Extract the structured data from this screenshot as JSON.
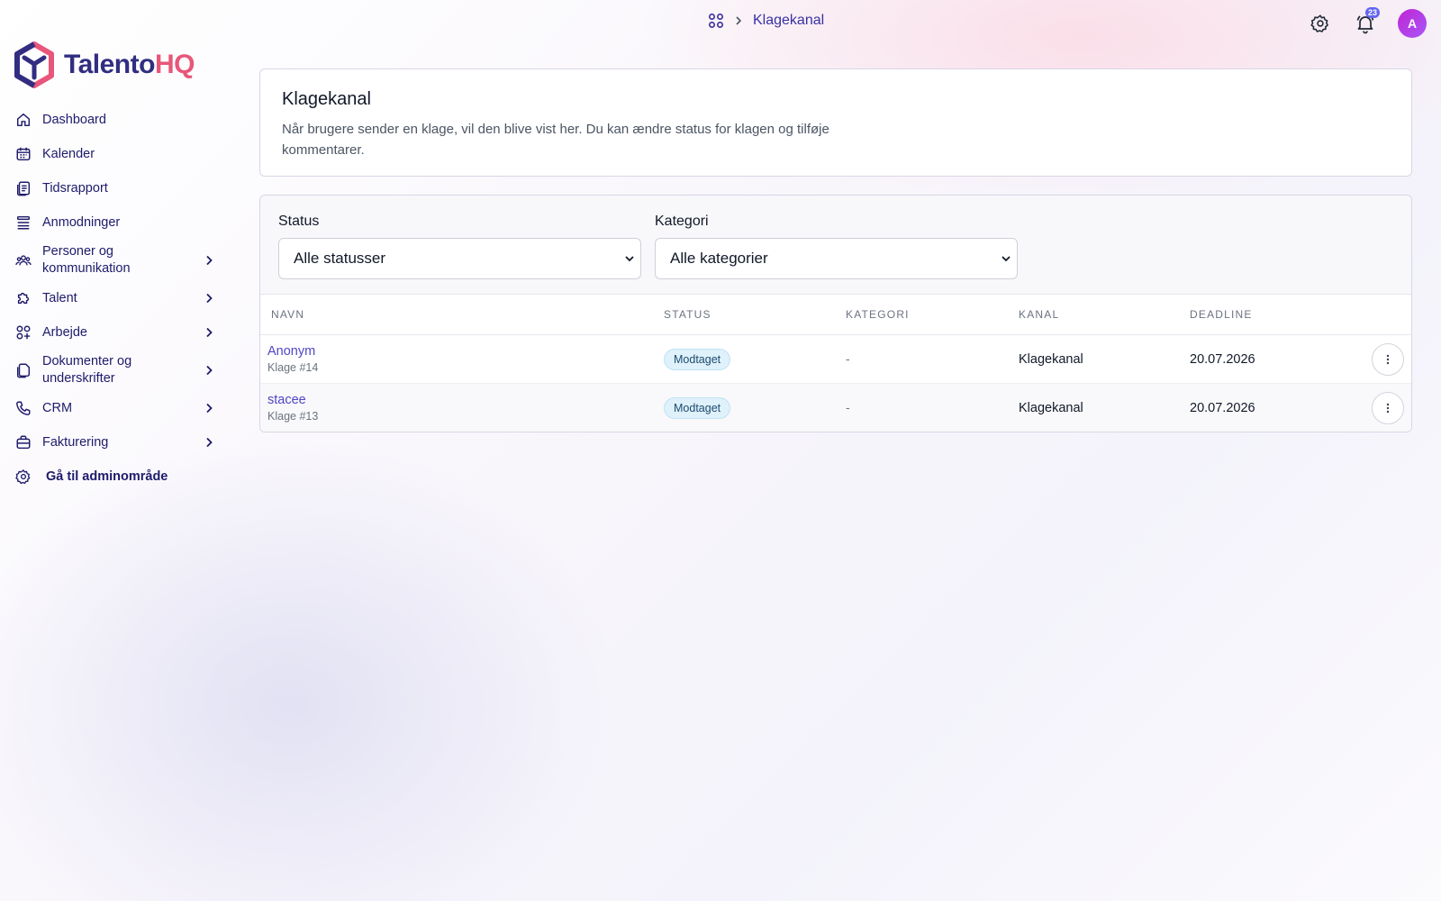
{
  "header": {
    "breadcrumb": "Klagekanal",
    "notification_count": "23",
    "avatar_initial": "A"
  },
  "brand": {
    "name_main": "Talento",
    "name_accent": "HQ",
    "colors": {
      "navy": "#312e81",
      "pink": "#e8567a"
    }
  },
  "sidebar": {
    "items": [
      {
        "label": "Dashboard",
        "icon": "home-icon"
      },
      {
        "label": "Kalender",
        "icon": "calendar-icon"
      },
      {
        "label": "Tidsrapport",
        "icon": "timesheet-icon"
      },
      {
        "label": "Anmodninger",
        "icon": "list-icon"
      },
      {
        "label": "Personer og kommunikation",
        "icon": "people-icon",
        "expandable": true
      },
      {
        "label": "Talent",
        "icon": "puzzle-icon",
        "expandable": true
      },
      {
        "label": "Arbejde",
        "icon": "apps-icon",
        "expandable": true
      },
      {
        "label": "Dokumenter og underskrifter",
        "icon": "documents-icon",
        "expandable": true
      },
      {
        "label": "CRM",
        "icon": "phone-icon",
        "expandable": true
      },
      {
        "label": "Fakturering",
        "icon": "briefcase-icon",
        "expandable": true
      },
      {
        "label": "Gå til adminområde",
        "icon": "gear-icon"
      }
    ]
  },
  "intro": {
    "title": "Klagekanal",
    "description": "Når brugere sender en klage, vil den blive vist her. Du kan ændre status for klagen og tilføje kommentarer."
  },
  "filters": {
    "status_label": "Status",
    "status_value": "Alle statusser",
    "category_label": "Kategori",
    "category_value": "Alle kategorier"
  },
  "table": {
    "columns": [
      "NAVN",
      "STATUS",
      "KATEGORI",
      "KANAL",
      "DEADLINE"
    ],
    "rows": [
      {
        "name": "Anonym",
        "sub": "Klage #14",
        "status": "Modtaget",
        "category": "-",
        "channel": "Klagekanal",
        "deadline": "20.07.2026"
      },
      {
        "name": "stacee",
        "sub": "Klage #13",
        "status": "Modtaget",
        "category": "-",
        "channel": "Klagekanal",
        "deadline": "20.07.2026"
      }
    ]
  }
}
